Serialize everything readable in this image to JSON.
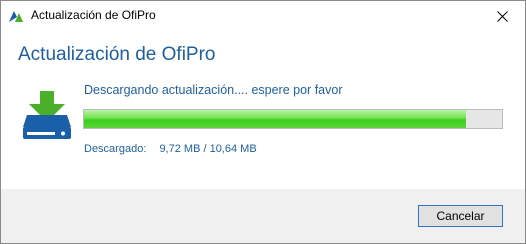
{
  "window": {
    "title": "Actualización de OfiPro",
    "close_glyph": "✕"
  },
  "heading": "Actualización de OfiPro",
  "status": "Descargando actualización.... espere por favor",
  "progress": {
    "fraction": 0.914
  },
  "downloaded": {
    "label": "Descargado:",
    "value": "9,72 MB / 10,64 MB"
  },
  "buttons": {
    "cancel": "Cancelar"
  },
  "icons": {
    "app": "app-logo-icon",
    "download": "download-drive-icon",
    "close": "close-icon"
  },
  "colors": {
    "heading": "#1f5f9f",
    "progress_green": "#3ccf1c",
    "icon_blue": "#1a5fa8",
    "icon_green": "#4caf2a"
  }
}
